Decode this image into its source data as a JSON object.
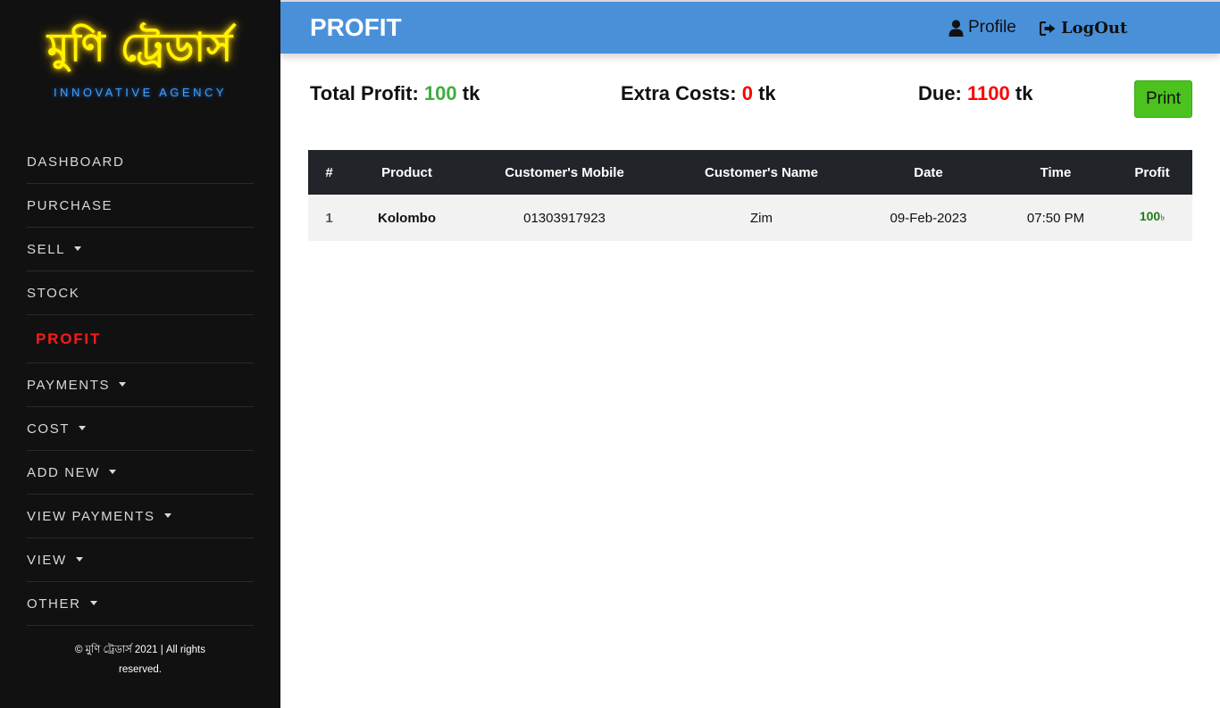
{
  "brand": {
    "name": "মুণি ট্রেডার্স",
    "tagline": "INNOVATIVE AGENCY"
  },
  "sidebar": {
    "items": [
      {
        "label": "DASHBOARD",
        "dropdown": false
      },
      {
        "label": "PURCHASE",
        "dropdown": false
      },
      {
        "label": "SELL",
        "dropdown": true
      },
      {
        "label": "STOCK",
        "dropdown": false
      },
      {
        "label": "PROFIT",
        "dropdown": false,
        "active": true
      },
      {
        "label": "PAYMENTS",
        "dropdown": true
      },
      {
        "label": "COST",
        "dropdown": true
      },
      {
        "label": "ADD NEW",
        "dropdown": true
      },
      {
        "label": "VIEW PAYMENTS",
        "dropdown": true
      },
      {
        "label": "VIEW",
        "dropdown": true
      },
      {
        "label": "OTHER",
        "dropdown": true
      }
    ],
    "footer_line1": "© মুণি ট্রেডার্স 2021 | All rights",
    "footer_line2": "reserved."
  },
  "header": {
    "title": "PROFIT",
    "profile_label": "Profile",
    "logout_label": "LogOut"
  },
  "summary": {
    "total_profit_label": "Total Profit:",
    "total_profit_value": "100",
    "extra_costs_label": "Extra Costs:",
    "extra_costs_value": "0",
    "due_label": "Due:",
    "due_value": "1100",
    "unit": "tk",
    "print_label": "Print"
  },
  "table": {
    "headers": [
      "#",
      "Product",
      "Customer's Mobile",
      "Customer's Name",
      "Date",
      "Time",
      "Profit"
    ],
    "rows": [
      {
        "index": "1",
        "product": "Kolombo",
        "mobile": "01303917923",
        "name": "Zim",
        "date": "09-Feb-2023",
        "time": "07:50 PM",
        "profit": "100",
        "currency": "৳"
      }
    ]
  },
  "colors": {
    "sidebar_bg": "#111111",
    "header_bg": "#4a90d9",
    "accent_active": "#ff1a1a",
    "profit_green": "#3fad3f",
    "due_red": "#ff0000",
    "print_btn": "#4cc21f"
  }
}
